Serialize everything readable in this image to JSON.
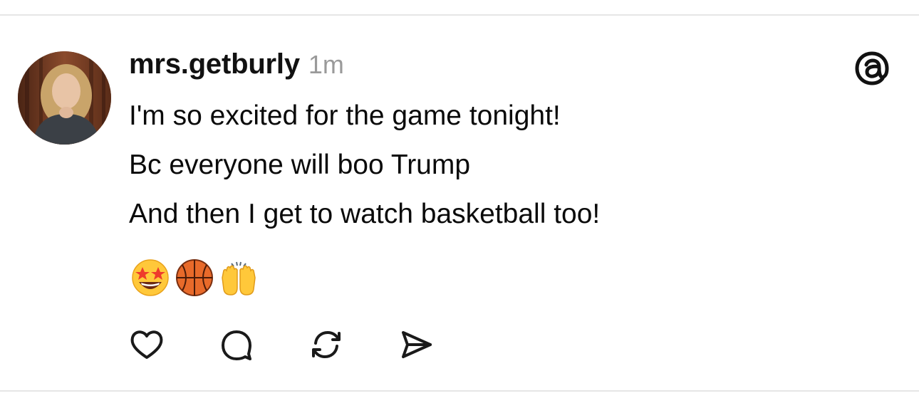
{
  "post": {
    "username": "mrs.getburly",
    "timestamp": "1m",
    "lines": [
      "I'm so excited for the game tonight!",
      "Bc everyone will boo Trump",
      "And then I get to watch basketball too!"
    ],
    "emojis": [
      "star-struck-face",
      "basketball",
      "raising-hands"
    ]
  },
  "actions": [
    "like",
    "reply",
    "repost",
    "share"
  ],
  "icons": {
    "brand": "threads-logo",
    "like": "heart-icon",
    "reply": "comment-bubble-icon",
    "repost": "repost-icon",
    "share": "send-icon"
  },
  "colors": {
    "text": "#0a0a0a",
    "muted": "#9a9a9a",
    "divider": "#e6e6e6",
    "icon": "#1a1a1a"
  }
}
